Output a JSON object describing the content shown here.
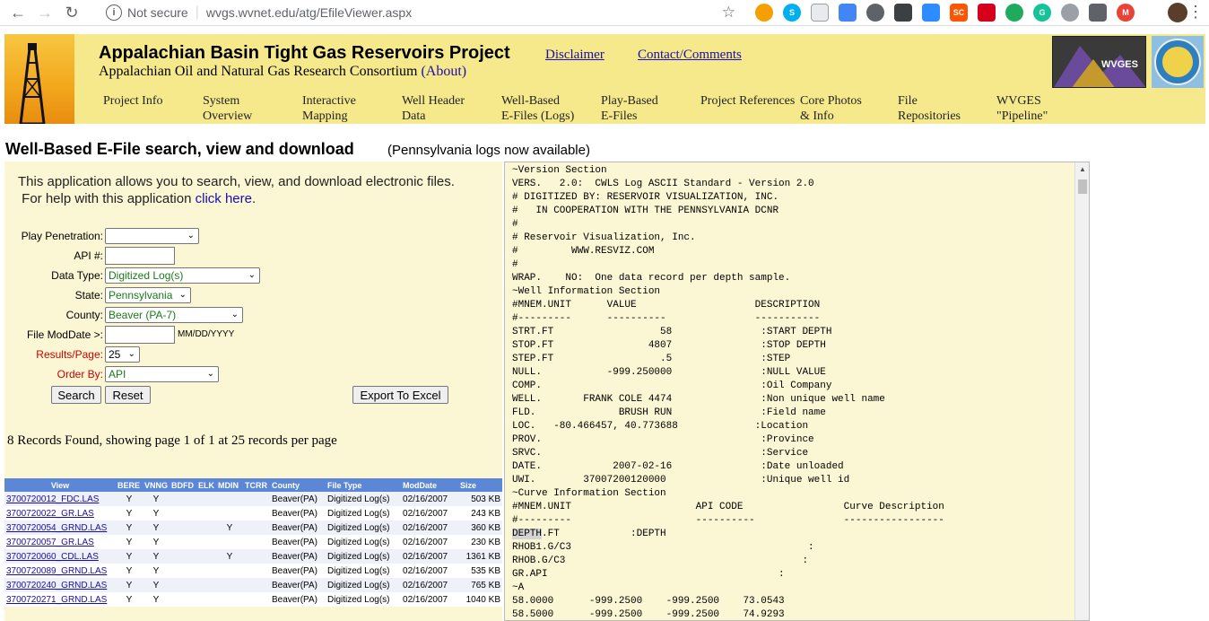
{
  "browser": {
    "security": "Not secure",
    "url": "wvgs.wvnet.edu/atg/EfileViewer.aspx"
  },
  "header": {
    "title": "Appalachian Basin Tight Gas Reservoirs Project",
    "subtitle": "Appalachian Oil and Natural Gas Research Consortium",
    "about": "(About)",
    "disclaimer": "Disclaimer",
    "contact": "Contact/Comments",
    "logo_text": "WVGES",
    "menu": [
      {
        "l1": "Project Info",
        "l2": ""
      },
      {
        "l1": "System",
        "l2": "Overview"
      },
      {
        "l1": "Interactive",
        "l2": "Mapping"
      },
      {
        "l1": "Well Header",
        "l2": "Data"
      },
      {
        "l1": "Well-Based",
        "l2": "E-Files (Logs)"
      },
      {
        "l1": "Play-Based",
        "l2": "E-Files"
      },
      {
        "l1": "Project References",
        "l2": ""
      },
      {
        "l1": "Core Photos",
        "l2": "& Info"
      },
      {
        "l1": "File",
        "l2": "Repositories"
      },
      {
        "l1": "WVGES",
        "l2": "\"Pipeline\""
      }
    ]
  },
  "page": {
    "title": "Well-Based E-File search, view and download",
    "note": "(Pennsylvania logs now available)"
  },
  "form": {
    "intro1": "This application allows you to search, view, and download electronic files.",
    "intro2": "For help with this application",
    "help_link": "click here",
    "play_label": "Play Penetration:",
    "play_value": "",
    "api_label": "API #:",
    "datatype_label": "Data Type:",
    "datatype_value": "Digitized Log(s)",
    "state_label": "State:",
    "state_value": "Pennsylvania",
    "county_label": "County:",
    "county_value": "Beaver (PA-7)",
    "moddate_label": "File ModDate >:",
    "moddate_hint": "MM/DD/YYYY",
    "results_label": "Results/Page:",
    "results_value": "25",
    "order_label": "Order By:",
    "order_value": "API",
    "search": "Search",
    "reset": "Reset",
    "export": "Export To Excel",
    "records": "8 Records Found, showing page 1 of 1 at 25 records per page"
  },
  "table": {
    "headers": [
      "View",
      "BERE",
      "VNNG",
      "BDFD",
      "ELK",
      "MDIN",
      "TCRR",
      "County",
      "File Type",
      "ModDate",
      "Size"
    ],
    "rows": [
      [
        "3700720012_FDC.LAS",
        "Y",
        "Y",
        "",
        "",
        "",
        "",
        "Beaver(PA)",
        "Digitized Log(s)",
        "02/16/2007",
        "503 KB"
      ],
      [
        "3700720022_GR.LAS",
        "Y",
        "Y",
        "",
        "",
        "",
        "",
        "Beaver(PA)",
        "Digitized Log(s)",
        "02/16/2007",
        "243 KB"
      ],
      [
        "3700720054_GRND.LAS",
        "Y",
        "Y",
        "",
        "",
        "Y",
        "",
        "Beaver(PA)",
        "Digitized Log(s)",
        "02/16/2007",
        "360 KB"
      ],
      [
        "3700720057_GR.LAS",
        "Y",
        "Y",
        "",
        "",
        "",
        "",
        "Beaver(PA)",
        "Digitized Log(s)",
        "02/16/2007",
        "230 KB"
      ],
      [
        "3700720060_CDL.LAS",
        "Y",
        "Y",
        "",
        "",
        "Y",
        "",
        "Beaver(PA)",
        "Digitized Log(s)",
        "02/16/2007",
        "1361 KB"
      ],
      [
        "3700720089_GRND.LAS",
        "Y",
        "Y",
        "",
        "",
        "",
        "",
        "Beaver(PA)",
        "Digitized Log(s)",
        "02/16/2007",
        "535 KB"
      ],
      [
        "3700720240_GRND.LAS",
        "Y",
        "Y",
        "",
        "",
        "",
        "",
        "Beaver(PA)",
        "Digitized Log(s)",
        "02/16/2007",
        "765 KB"
      ],
      [
        "3700720271_GRND.LAS",
        "Y",
        "Y",
        "",
        "",
        "",
        "",
        "Beaver(PA)",
        "Digitized Log(s)",
        "02/16/2007",
        "1040 KB"
      ]
    ]
  },
  "viewer": {
    "lines": [
      "~Version Section",
      "VERS.   2.0:  CWLS Log ASCII Standard - Version 2.0",
      "# DIGITIZED BY: RESERVOIR VISUALIZATION, INC.",
      "#   IN COOPERATION WITH THE PENNSYLVANIA DCNR",
      "#",
      "# Reservoir Visualization, Inc.",
      "#         WWW.RESVIZ.COM",
      "#",
      "WRAP.    NO:  One data record per depth sample.",
      "~Well Information Section",
      "#MNEM.UNIT      VALUE                    DESCRIPTION",
      "#---------      ----------               -----------",
      "STRT.FT                  58               :START DEPTH",
      "STOP.FT                4807               :STOP DEPTH",
      "STEP.FT                  .5               :STEP",
      "NULL.           -999.250000               :NULL VALUE",
      "COMP.                                     :Oil Company",
      "WELL.       FRANK COLE 4474               :Non unique well name",
      "FLD.              BRUSH RUN               :Field name",
      "LOC.   -80.466457, 40.773688             :Location",
      "PROV.                                     :Province",
      "SRVC.                                     :Service",
      "DATE.            2007-02-16               :Date unloaded",
      "UWI.        37007200120000                :Unique well id",
      "~Curve Information Section",
      "#MNEM.UNIT                     API CODE                 Curve Description",
      "#---------                     ----------               -----------------",
      "DEPTH.FT            :DEPTH",
      "RHOB1.G/C3                                        :",
      "RHOB.G/C3                                        :",
      "GR.API                                       :",
      "~A",
      "58.0000      -999.2500    -999.2500    73.0543",
      "58.5000      -999.2500    -999.2500    74.9293"
    ]
  }
}
